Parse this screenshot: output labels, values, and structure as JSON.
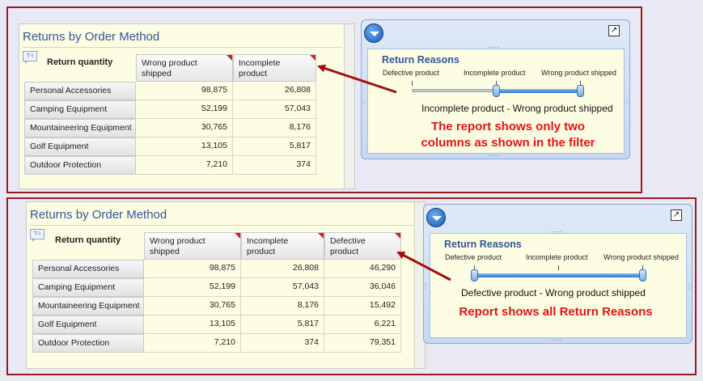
{
  "top": {
    "report": {
      "title": "Returns by Order Method",
      "corner_label": "Return quantity",
      "columns": [
        "Wrong product shipped",
        "Incomplete product"
      ],
      "rows": [
        {
          "label": "Personal Accessories",
          "values": [
            "98,875",
            "26,808"
          ]
        },
        {
          "label": "Camping Equipment",
          "values": [
            "52,199",
            "57,043"
          ]
        },
        {
          "label": "Mountaineering Equipment",
          "values": [
            "30,765",
            "8,176"
          ]
        },
        {
          "label": "Golf Equipment",
          "values": [
            "13,105",
            "5,817"
          ]
        },
        {
          "label": "Outdoor Protection",
          "values": [
            "7,210",
            "374"
          ]
        }
      ]
    },
    "filter": {
      "title": "Return Reasons",
      "ticks": [
        "Defective product",
        "Incomplete product",
        "Wrong product shipped"
      ],
      "range_text": "Incomplete product - Wrong product shipped",
      "selected_from": 1,
      "selected_to": 2
    },
    "callout": [
      "The report shows only two",
      "columns as shown in the filter"
    ]
  },
  "bottom": {
    "report": {
      "title": "Returns by Order Method",
      "corner_label": "Return quantity",
      "columns": [
        "Wrong product shipped",
        "Incomplete product",
        "Defective product"
      ],
      "rows": [
        {
          "label": "Personal Accessories",
          "values": [
            "98,875",
            "26,808",
            "46,290"
          ]
        },
        {
          "label": "Camping Equipment",
          "values": [
            "52,199",
            "57,043",
            "36,046"
          ]
        },
        {
          "label": "Mountaineering Equipment",
          "values": [
            "30,765",
            "8,176",
            "15,492"
          ]
        },
        {
          "label": "Golf Equipment",
          "values": [
            "13,105",
            "5,817",
            "6,221"
          ]
        },
        {
          "label": "Outdoor Protection",
          "values": [
            "7,210",
            "374",
            "79,351"
          ]
        }
      ]
    },
    "filter": {
      "title": "Return Reasons",
      "ticks": [
        "Defective product",
        "Incomplete product",
        "Wrong product shipped"
      ],
      "range_text": "Defective product - Wrong product shipped",
      "selected_from": 0,
      "selected_to": 2
    },
    "callout": [
      "Report shows all Return Reasons"
    ]
  },
  "colors": {
    "accent": "#9b1b1b",
    "callout": "#e01515",
    "title": "#34579a"
  },
  "icons": {
    "widget_menu": "chevron-down-icon",
    "maximize": "maximize-icon",
    "note": "note-icon"
  }
}
